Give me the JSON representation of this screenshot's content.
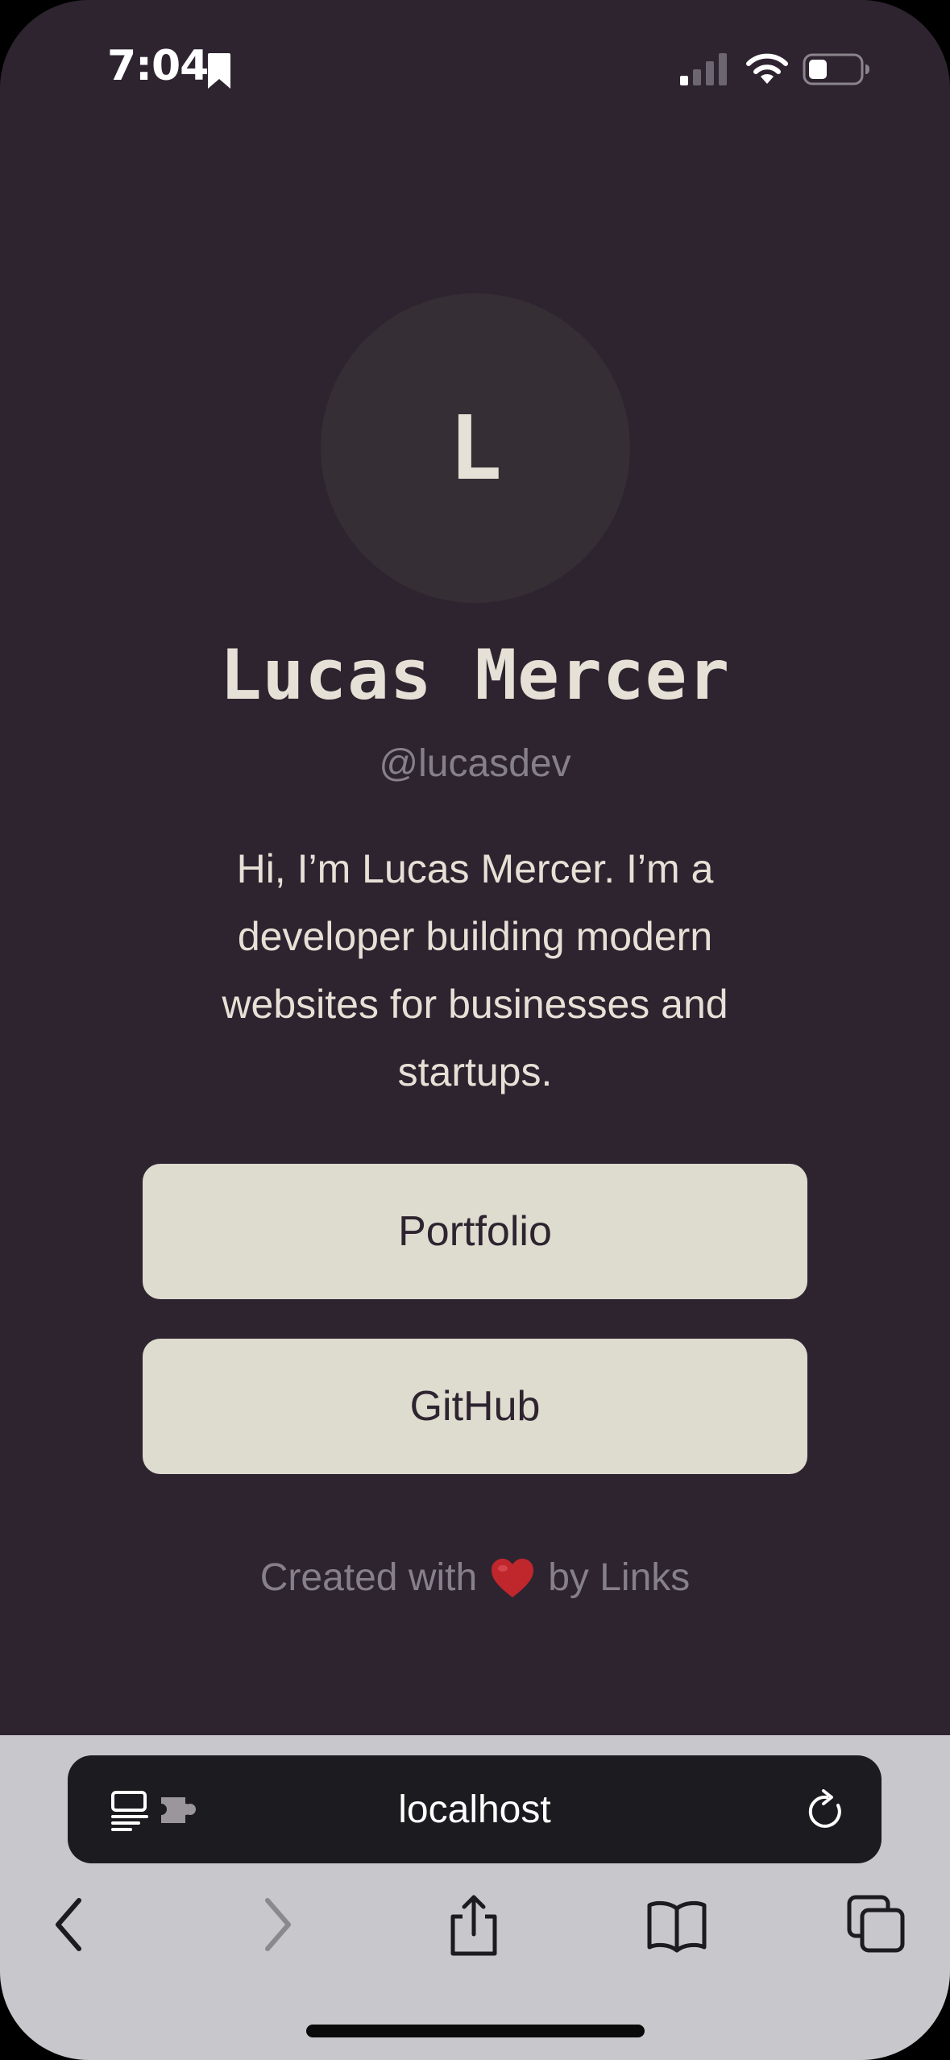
{
  "status_bar": {
    "time": "7:04",
    "icons": [
      "bookmark-icon",
      "cellular-signal-icon",
      "wifi-icon",
      "battery-icon"
    ]
  },
  "profile": {
    "avatar_initial": "L",
    "name": "Lucas Mercer",
    "handle": "@lucasdev",
    "bio": "Hi, I’m Lucas Mercer. I’m a developer building modern websites for businesses and startups."
  },
  "links": [
    {
      "label": "Portfolio"
    },
    {
      "label": "GitHub"
    }
  ],
  "footer": {
    "prefix": "Created with",
    "icon": "heart-icon",
    "suffix": "by Links"
  },
  "browser": {
    "url": "localhost",
    "toolbar_icons": [
      "back-icon",
      "forward-icon",
      "share-icon",
      "bookmarks-icon",
      "tabs-icon"
    ]
  },
  "colors": {
    "page_background": "#2e2430",
    "avatar_background": "#352e35",
    "primary_text": "#e6e1d6",
    "muted_text": "#85808a",
    "button_background": "#dedbcf",
    "button_text": "#2e2430",
    "heart": "#c0272d",
    "browser_chrome": "#c8c7cc",
    "address_bar": "#1c1b1f"
  }
}
